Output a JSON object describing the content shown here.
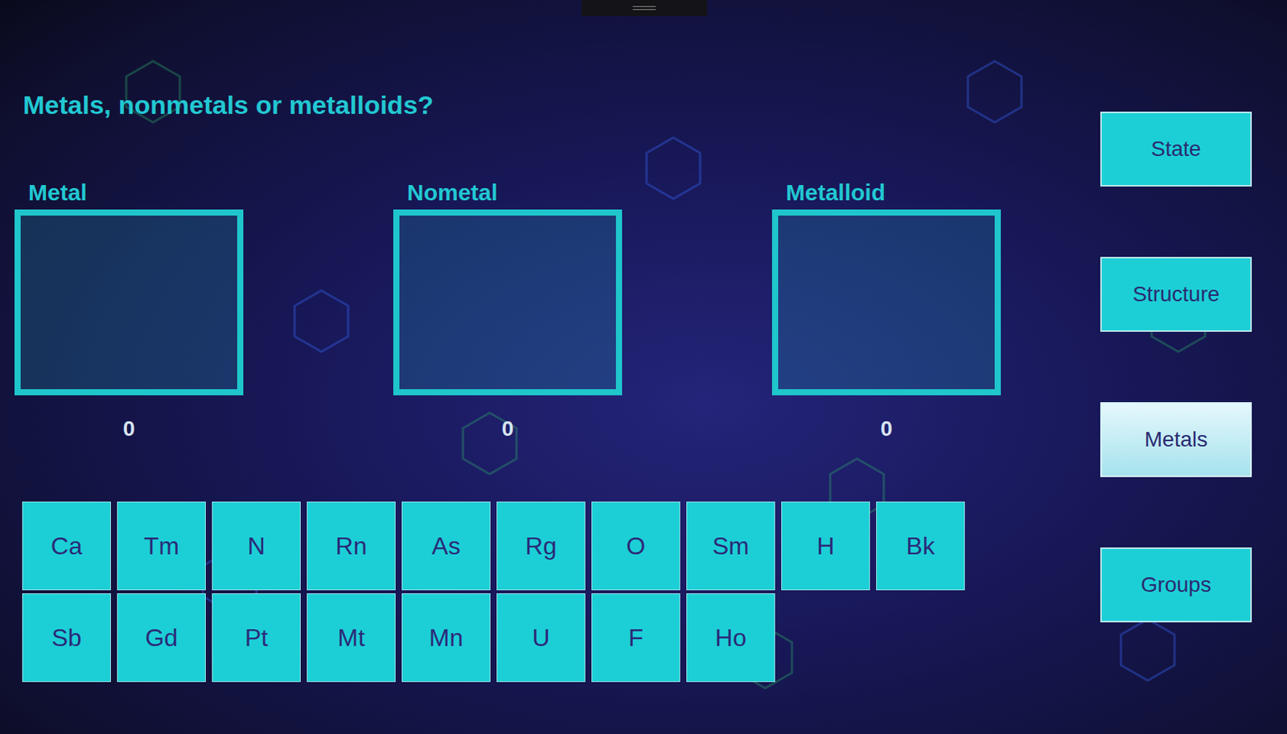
{
  "title": "Metals, nonmetals or metalloids?",
  "bins": [
    {
      "label": "Metal",
      "count": "0"
    },
    {
      "label": "Nometal",
      "count": "0"
    },
    {
      "label": "Metalloid",
      "count": "0"
    }
  ],
  "elements": [
    "Ca",
    "Tm",
    "N",
    "Rn",
    "As",
    "Rg",
    "O",
    "Sm",
    "H",
    "Bk",
    "Sb",
    "Gd",
    "Pt",
    "Mt",
    "Mn",
    "U",
    "F",
    "Ho"
  ],
  "menu": [
    {
      "label": "State",
      "selected": false
    },
    {
      "label": "Structure",
      "selected": false
    },
    {
      "label": "Metals",
      "selected": true
    },
    {
      "label": "Groups",
      "selected": false
    }
  ]
}
